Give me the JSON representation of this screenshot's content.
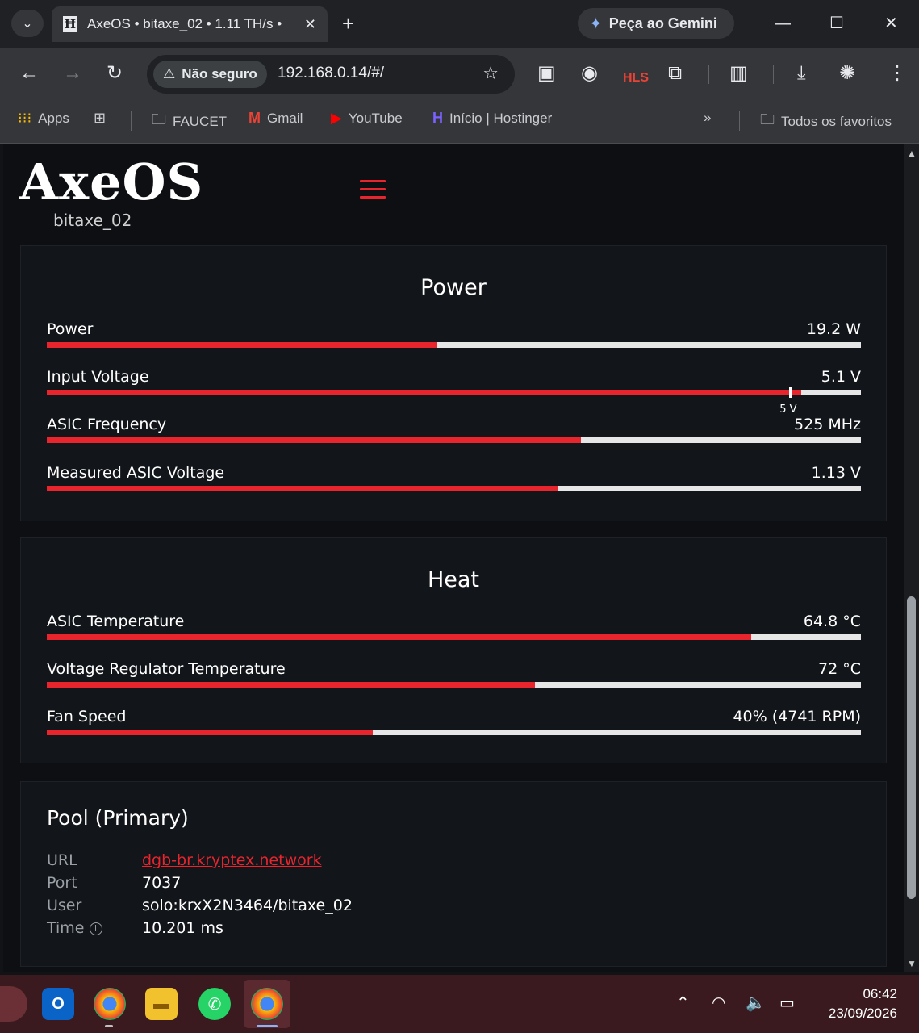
{
  "browser": {
    "tab_title": "AxeOS • bitaxe_02 • 1.11 TH/s •",
    "tab_favicon": "Ħ",
    "gemini_label": "Peça ao Gemini",
    "security_label": "Não seguro",
    "url": "192.168.0.14/#/",
    "hls_label": "HLS",
    "bookmarks": [
      {
        "label": "Apps"
      },
      {
        "label": "FAUCET"
      },
      {
        "label": "Gmail"
      },
      {
        "label": "YouTube"
      },
      {
        "label": "Início | Hostinger"
      }
    ],
    "all_bookmarks_label": "Todos os favoritos"
  },
  "app": {
    "logo": "AxeOS",
    "hostname": "bitaxe_02"
  },
  "power": {
    "title": "Power",
    "metrics": [
      {
        "label": "Power",
        "value": "19.2 W",
        "fraction": 0.48
      },
      {
        "label": "Input Voltage",
        "value": "5.1 V",
        "fraction": 0.927,
        "marker_label": "5 V",
        "marker_fraction": 0.912
      },
      {
        "label": "ASIC Frequency",
        "value": "525 MHz",
        "fraction": 0.656
      },
      {
        "label": "Measured ASIC Voltage",
        "value": "1.13 V",
        "fraction": 0.628
      }
    ]
  },
  "heat": {
    "title": "Heat",
    "metrics": [
      {
        "label": "ASIC Temperature",
        "value": "64.8 °C",
        "fraction": 0.865
      },
      {
        "label": "Voltage Regulator Temperature",
        "value": "72 °C",
        "fraction": 0.6
      },
      {
        "label": "Fan Speed",
        "value": "40% (4741 RPM)",
        "fraction": 0.4
      }
    ]
  },
  "pool": {
    "title": "Pool (Primary)",
    "url_label": "URL",
    "url_value": "dgb-br.kryptex.network",
    "port_label": "Port",
    "port_value": "7037",
    "user_label": "User",
    "user_value": "solo:krxX2N3464/bitaxe_02",
    "time_label": "Time",
    "time_value": "10.201 ms"
  },
  "taskbar": {
    "time": "06:42",
    "date": "23/09/2026"
  },
  "colors": {
    "accent": "#e8252d",
    "track": "#e6e6e6",
    "card_bg": "#12151a"
  }
}
